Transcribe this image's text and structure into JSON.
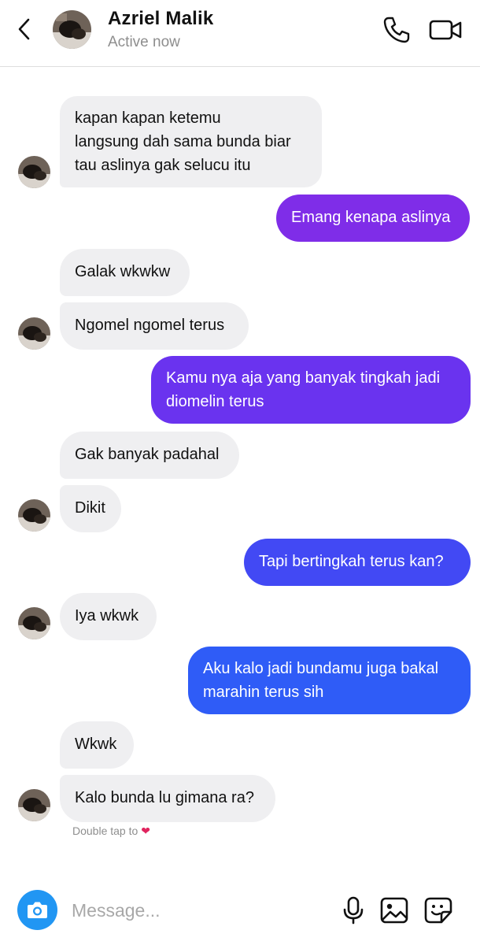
{
  "header": {
    "contact_name": "Azriel Malik",
    "status": "Active now",
    "icons": [
      "back-chevron-icon",
      "phone-icon",
      "video-camera-icon"
    ]
  },
  "messages": [
    {
      "from": "them",
      "text": "kapan kapan ketemu\nlangsung dah sama bunda biar\ntau aslinya gak selucu itu"
    },
    {
      "from": "me",
      "text": "Emang kenapa aslinya"
    },
    {
      "from": "them",
      "text": "Galak wkwkw"
    },
    {
      "from": "them",
      "text": "Ngomel ngomel terus"
    },
    {
      "from": "me",
      "text": "Kamu nya aja yang banyak tingkah jadi\ndiomelin terus"
    },
    {
      "from": "them",
      "text": "Gak banyak padahal"
    },
    {
      "from": "them",
      "text": "Dikit"
    },
    {
      "from": "me",
      "text": "Tapi bertingkah terus kan?"
    },
    {
      "from": "them",
      "text": "Iya wkwk"
    },
    {
      "from": "me",
      "text": "Aku kalo jadi bundamu juga bakal\nmarahin terus sih"
    },
    {
      "from": "them",
      "text": "Wkwk"
    },
    {
      "from": "them",
      "text": "Kalo bunda lu gimana ra?"
    }
  ],
  "double_tap_hint": "Double tap to",
  "composer": {
    "placeholder": "Message...",
    "icons": [
      "camera-icon",
      "microphone-icon",
      "gallery-icon",
      "sticker-icon"
    ]
  },
  "colors": {
    "outgoing_gradient": [
      "#8a2be2",
      "#6a3cf0",
      "#3a5af5",
      "#2962ff"
    ],
    "incoming_bubble": "#efeff1",
    "camera_button": "#2196f3",
    "heart": "#e0245e"
  }
}
